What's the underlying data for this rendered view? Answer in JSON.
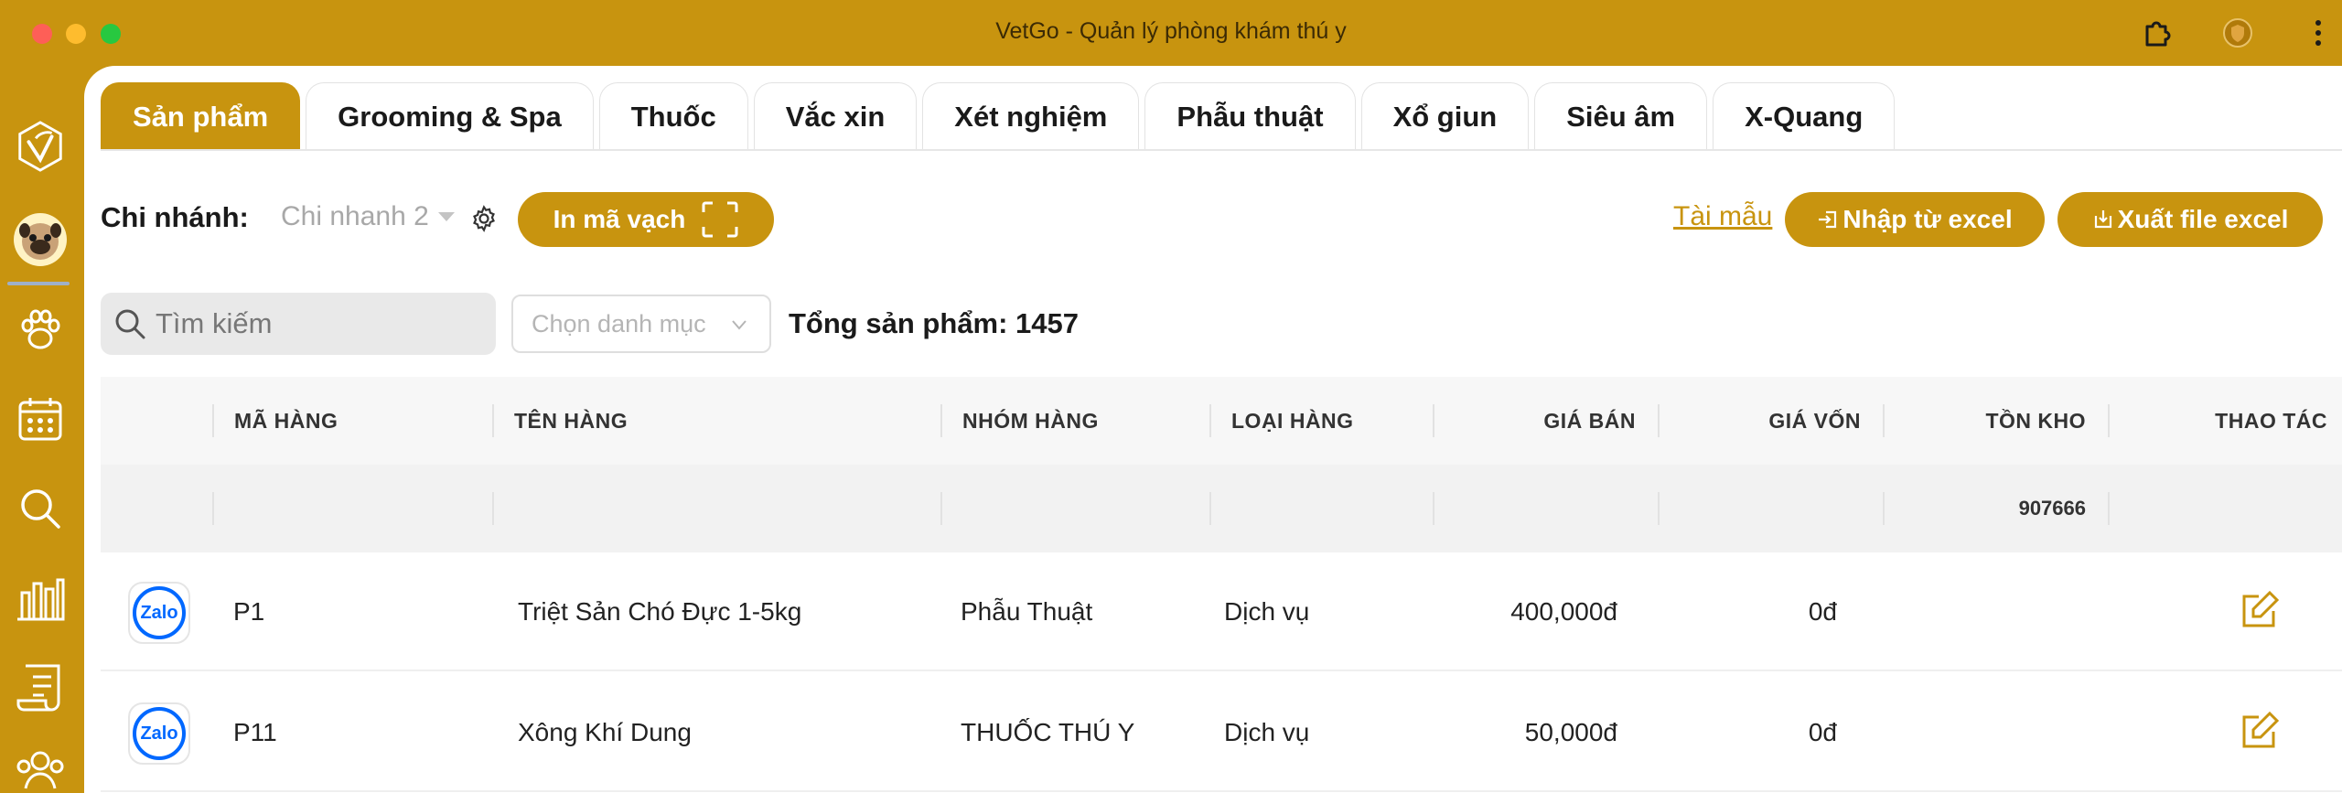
{
  "window": {
    "title": "VetGo - Quản lý phòng khám thú y"
  },
  "colors": {
    "accent": "#C8940F",
    "zalo": "#0068ff"
  },
  "sidebar": {
    "items": [
      {
        "icon": "vetgo-logo-icon"
      },
      {
        "icon": "avatar"
      },
      {
        "icon": "paw-icon"
      },
      {
        "icon": "calendar-icon"
      },
      {
        "icon": "search-icon"
      },
      {
        "icon": "bar-chart-icon"
      },
      {
        "icon": "document-icon"
      },
      {
        "icon": "users-icon"
      }
    ]
  },
  "tabs": [
    {
      "label": "Sản phẩm",
      "active": true
    },
    {
      "label": "Grooming & Spa"
    },
    {
      "label": "Thuốc"
    },
    {
      "label": "Vắc xin"
    },
    {
      "label": "Xét nghiệm"
    },
    {
      "label": "Phẫu thuật"
    },
    {
      "label": "Xổ giun"
    },
    {
      "label": "Siêu âm"
    },
    {
      "label": "X-Quang"
    }
  ],
  "toolbar": {
    "branch_label": "Chi nhánh:",
    "branch_value": "Chi nhanh 2",
    "barcode_button": "In mã vạch",
    "template_link": "Tài mẫu",
    "import_button": "Nhập từ excel",
    "export_button": "Xuất file excel"
  },
  "filters": {
    "search_placeholder": "Tìm kiếm",
    "category_placeholder": "Chọn danh mục",
    "total_label": "Tổng sản phẩm: 1457"
  },
  "table": {
    "headers": [
      "MÃ HÀNG",
      "TÊN HÀNG",
      "NHÓM HÀNG",
      "LOẠI HÀNG",
      "GIÁ BÁN",
      "GIÁ VỐN",
      "TỒN KHO",
      "THAO TÁC"
    ],
    "summary_stock": "907666",
    "rows": [
      {
        "logo": "Zalo",
        "code": "P1",
        "name": "Triệt Sản Chó Đực 1-5kg",
        "group": "Phẫu Thuật",
        "type": "Dịch vụ",
        "price": "400,000đ",
        "cost": "0đ",
        "stock": ""
      },
      {
        "logo": "Zalo",
        "code": "P11",
        "name": "Xông Khí Dung",
        "group": "THUỐC THÚ Y",
        "type": "Dịch vụ",
        "price": "50,000đ",
        "cost": "0đ",
        "stock": ""
      }
    ]
  }
}
